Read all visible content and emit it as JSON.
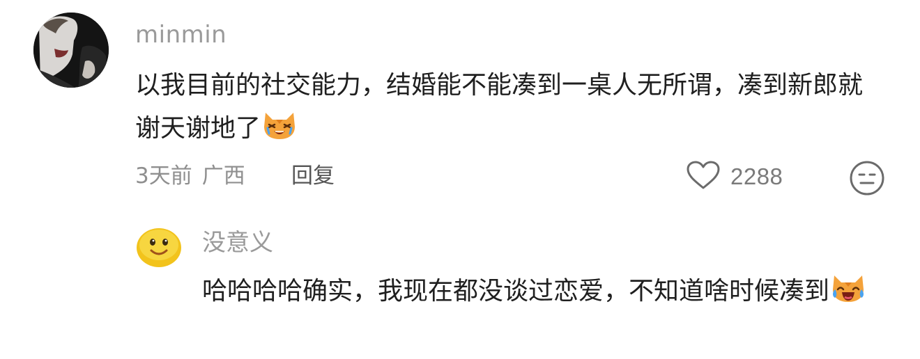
{
  "comment": {
    "username": "minmin",
    "text": "以我目前的社交能力，结婚能不能凑到一桌人无所谓，凑到新郎就谢天谢地了",
    "emoji": "crying-cat-emoji",
    "time": "3天前",
    "location": "广西",
    "reply_label": "回复",
    "like_count": "2288",
    "avatar": "dark-portrait-avatar"
  },
  "reply": {
    "username": "没意义",
    "text": "哈哈哈哈确实，我现在都没谈过恋爱，不知道啥时候凑到",
    "emoji": "laughing-crying-cat-emoji",
    "avatar": "smiley-face-avatar"
  },
  "colors": {
    "text_primary": "#1f1f1f",
    "text_secondary": "#9a9a9a",
    "cat_orange": "#f4a23a"
  }
}
